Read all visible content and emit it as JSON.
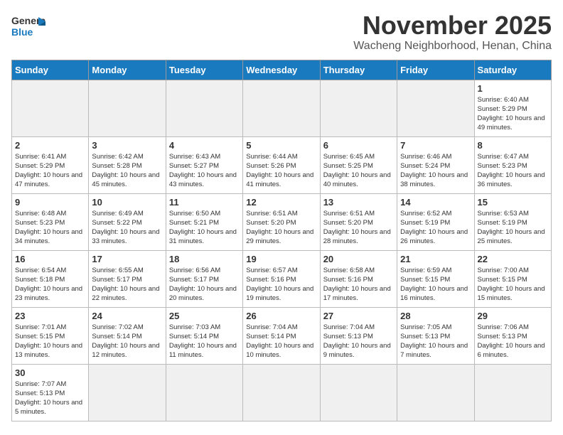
{
  "header": {
    "logo_line1": "General",
    "logo_line2": "Blue",
    "month": "November 2025",
    "location": "Wacheng Neighborhood, Henan, China"
  },
  "weekdays": [
    "Sunday",
    "Monday",
    "Tuesday",
    "Wednesday",
    "Thursday",
    "Friday",
    "Saturday"
  ],
  "weeks": [
    [
      {
        "day": "",
        "empty": true
      },
      {
        "day": "",
        "empty": true
      },
      {
        "day": "",
        "empty": true
      },
      {
        "day": "",
        "empty": true
      },
      {
        "day": "",
        "empty": true
      },
      {
        "day": "",
        "empty": true
      },
      {
        "day": "1",
        "sunrise": "6:40 AM",
        "sunset": "5:29 PM",
        "daylight": "10 hours and 49 minutes."
      }
    ],
    [
      {
        "day": "2",
        "sunrise": "6:41 AM",
        "sunset": "5:29 PM",
        "daylight": "10 hours and 47 minutes."
      },
      {
        "day": "3",
        "sunrise": "6:42 AM",
        "sunset": "5:28 PM",
        "daylight": "10 hours and 45 minutes."
      },
      {
        "day": "4",
        "sunrise": "6:43 AM",
        "sunset": "5:27 PM",
        "daylight": "10 hours and 43 minutes."
      },
      {
        "day": "5",
        "sunrise": "6:44 AM",
        "sunset": "5:26 PM",
        "daylight": "10 hours and 41 minutes."
      },
      {
        "day": "6",
        "sunrise": "6:45 AM",
        "sunset": "5:25 PM",
        "daylight": "10 hours and 40 minutes."
      },
      {
        "day": "7",
        "sunrise": "6:46 AM",
        "sunset": "5:24 PM",
        "daylight": "10 hours and 38 minutes."
      },
      {
        "day": "8",
        "sunrise": "6:47 AM",
        "sunset": "5:23 PM",
        "daylight": "10 hours and 36 minutes."
      }
    ],
    [
      {
        "day": "9",
        "sunrise": "6:48 AM",
        "sunset": "5:23 PM",
        "daylight": "10 hours and 34 minutes."
      },
      {
        "day": "10",
        "sunrise": "6:49 AM",
        "sunset": "5:22 PM",
        "daylight": "10 hours and 33 minutes."
      },
      {
        "day": "11",
        "sunrise": "6:50 AM",
        "sunset": "5:21 PM",
        "daylight": "10 hours and 31 minutes."
      },
      {
        "day": "12",
        "sunrise": "6:51 AM",
        "sunset": "5:20 PM",
        "daylight": "10 hours and 29 minutes."
      },
      {
        "day": "13",
        "sunrise": "6:51 AM",
        "sunset": "5:20 PM",
        "daylight": "10 hours and 28 minutes."
      },
      {
        "day": "14",
        "sunrise": "6:52 AM",
        "sunset": "5:19 PM",
        "daylight": "10 hours and 26 minutes."
      },
      {
        "day": "15",
        "sunrise": "6:53 AM",
        "sunset": "5:19 PM",
        "daylight": "10 hours and 25 minutes."
      }
    ],
    [
      {
        "day": "16",
        "sunrise": "6:54 AM",
        "sunset": "5:18 PM",
        "daylight": "10 hours and 23 minutes."
      },
      {
        "day": "17",
        "sunrise": "6:55 AM",
        "sunset": "5:17 PM",
        "daylight": "10 hours and 22 minutes."
      },
      {
        "day": "18",
        "sunrise": "6:56 AM",
        "sunset": "5:17 PM",
        "daylight": "10 hours and 20 minutes."
      },
      {
        "day": "19",
        "sunrise": "6:57 AM",
        "sunset": "5:16 PM",
        "daylight": "10 hours and 19 minutes."
      },
      {
        "day": "20",
        "sunrise": "6:58 AM",
        "sunset": "5:16 PM",
        "daylight": "10 hours and 17 minutes."
      },
      {
        "day": "21",
        "sunrise": "6:59 AM",
        "sunset": "5:15 PM",
        "daylight": "10 hours and 16 minutes."
      },
      {
        "day": "22",
        "sunrise": "7:00 AM",
        "sunset": "5:15 PM",
        "daylight": "10 hours and 15 minutes."
      }
    ],
    [
      {
        "day": "23",
        "sunrise": "7:01 AM",
        "sunset": "5:15 PM",
        "daylight": "10 hours and 13 minutes."
      },
      {
        "day": "24",
        "sunrise": "7:02 AM",
        "sunset": "5:14 PM",
        "daylight": "10 hours and 12 minutes."
      },
      {
        "day": "25",
        "sunrise": "7:03 AM",
        "sunset": "5:14 PM",
        "daylight": "10 hours and 11 minutes."
      },
      {
        "day": "26",
        "sunrise": "7:04 AM",
        "sunset": "5:14 PM",
        "daylight": "10 hours and 10 minutes."
      },
      {
        "day": "27",
        "sunrise": "7:04 AM",
        "sunset": "5:13 PM",
        "daylight": "10 hours and 9 minutes."
      },
      {
        "day": "28",
        "sunrise": "7:05 AM",
        "sunset": "5:13 PM",
        "daylight": "10 hours and 7 minutes."
      },
      {
        "day": "29",
        "sunrise": "7:06 AM",
        "sunset": "5:13 PM",
        "daylight": "10 hours and 6 minutes."
      }
    ],
    [
      {
        "day": "30",
        "sunrise": "7:07 AM",
        "sunset": "5:13 PM",
        "daylight": "10 hours and 5 minutes."
      },
      {
        "day": "",
        "empty": true
      },
      {
        "day": "",
        "empty": true
      },
      {
        "day": "",
        "empty": true
      },
      {
        "day": "",
        "empty": true
      },
      {
        "day": "",
        "empty": true
      },
      {
        "day": "",
        "empty": true
      }
    ]
  ]
}
